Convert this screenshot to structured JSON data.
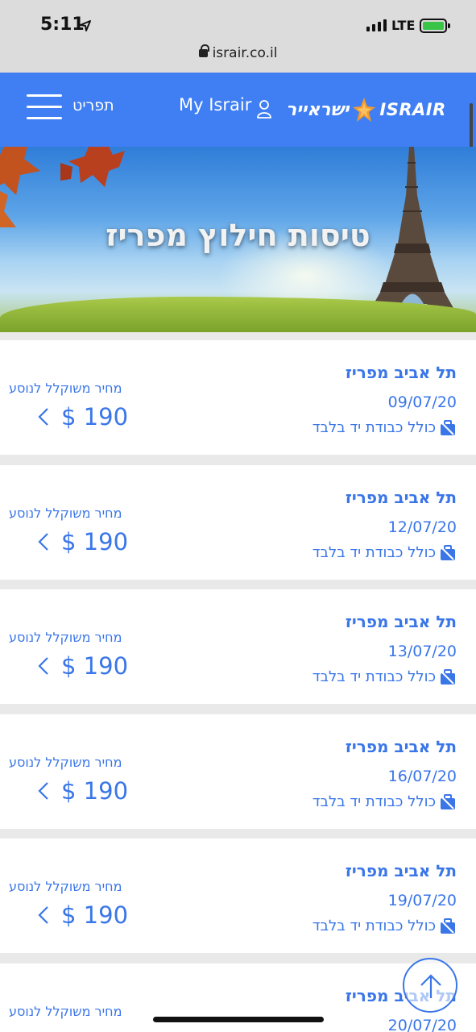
{
  "status_bar": {
    "time": "5:11",
    "network": "LTE"
  },
  "browser": {
    "url": "israir.co.il"
  },
  "header": {
    "menu_label": "תפריט",
    "account_label": "My Israir",
    "logo_hebrew": "ישראייר",
    "logo_english": "ISRAIR",
    "brand_color": "#3f7ff3"
  },
  "hero": {
    "title": "טיסות חילוץ מפריז"
  },
  "flights": [
    {
      "route": "תל אביב מפריז",
      "date": "09/07/20",
      "baggage": "כולל כבודת יד בלבד",
      "price_label": "מחיר משוקלל לנוסע",
      "price": "$ 190"
    },
    {
      "route": "תל אביב מפריז",
      "date": "12/07/20",
      "baggage": "כולל כבודת יד בלבד",
      "price_label": "מחיר משוקלל לנוסע",
      "price": "$ 190"
    },
    {
      "route": "תל אביב מפריז",
      "date": "13/07/20",
      "baggage": "כולל כבודת יד בלבד",
      "price_label": "מחיר משוקלל לנוסע",
      "price": "$ 190"
    },
    {
      "route": "תל אביב מפריז",
      "date": "16/07/20",
      "baggage": "כולל כבודת יד בלבד",
      "price_label": "מחיר משוקלל לנוסע",
      "price": "$ 190"
    },
    {
      "route": "תל אביב מפריז",
      "date": "19/07/20",
      "baggage": "כולל כבודת יד בלבד",
      "price_label": "מחיר משוקלל לנוסע",
      "price": "$ 190"
    },
    {
      "route": "תל אביב מפריז",
      "date": "20/07/20",
      "baggage": "",
      "price_label": "מחיר משוקלל לנוסע",
      "price": ""
    }
  ],
  "icons": {
    "location": "location-arrow-icon",
    "signal": "cell-signal-icon",
    "battery": "battery-charging-icon",
    "lock": "lock-icon",
    "menu": "hamburger-menu-icon",
    "user": "user-icon",
    "logo": "israir-star-logo-icon",
    "baggage": "hand-luggage-icon",
    "chevron": "chevron-left-icon",
    "scroll_top": "arrow-up-icon"
  },
  "colors": {
    "accent": "#3a76e8",
    "header": "#3f7ff3",
    "battery": "#37c447"
  }
}
